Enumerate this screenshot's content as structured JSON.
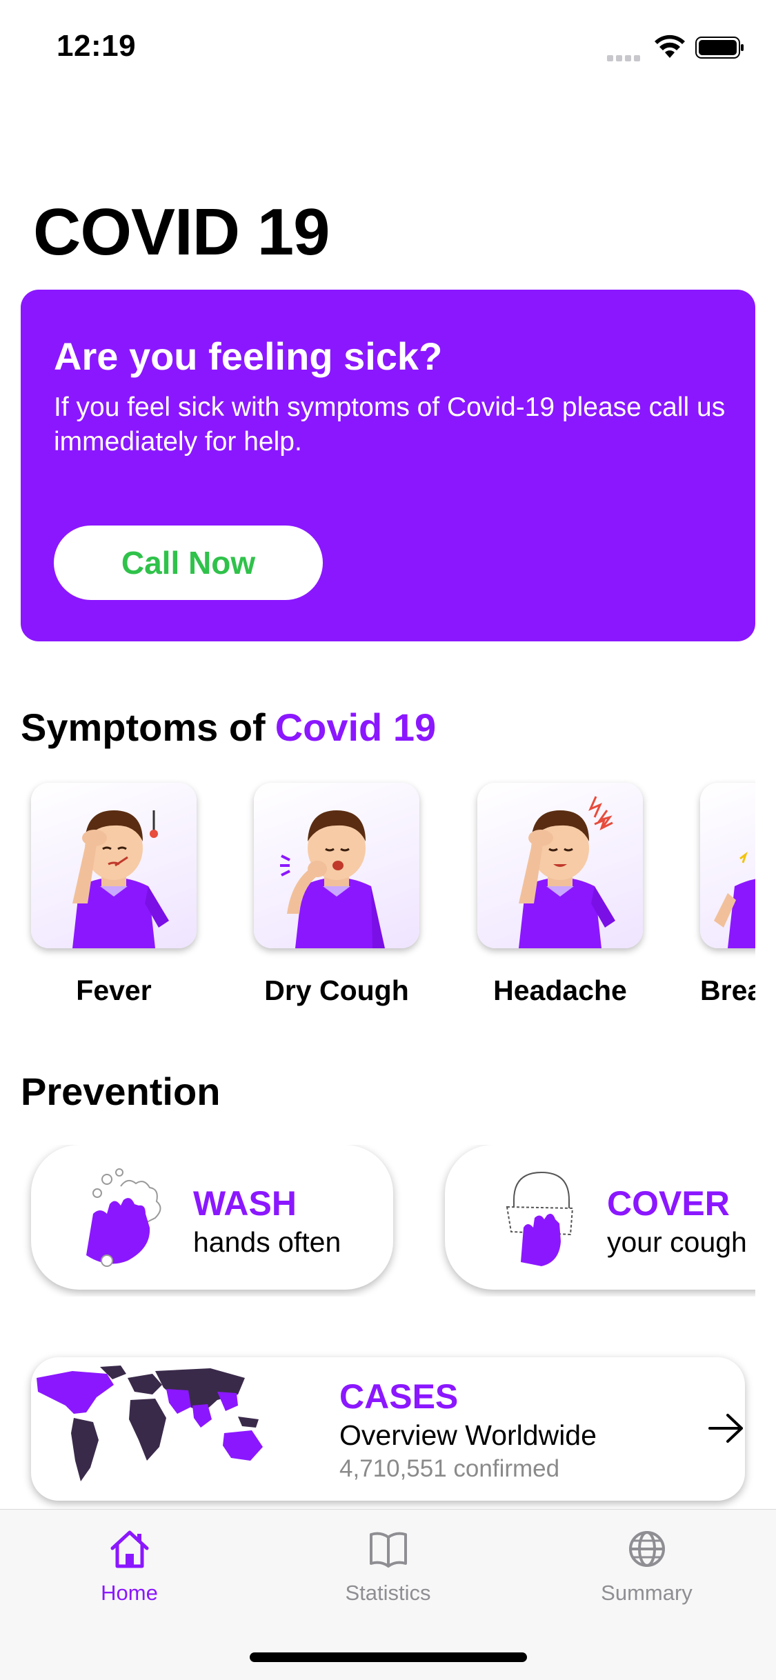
{
  "status_bar": {
    "time": "12:19"
  },
  "page_title": "COVID 19",
  "sick_card": {
    "title": "Are you feeling sick?",
    "text": "If you feel sick with symptoms of Covid-19 please call us immediately for help.",
    "button_label": "Call Now"
  },
  "symptoms_section": {
    "title": "Symptoms of",
    "title_accent": "Covid 19",
    "items": [
      {
        "label": "Fever",
        "icon": "fever-icon"
      },
      {
        "label": "Dry Cough",
        "icon": "dry-cough-icon"
      },
      {
        "label": "Headache",
        "icon": "headache-icon"
      },
      {
        "label": "Breathlessness",
        "icon": "breathing-icon"
      }
    ]
  },
  "prevention_section": {
    "title": "Prevention",
    "items": [
      {
        "heading": "WASH",
        "sub": "hands often",
        "icon": "hand-wash-icon"
      },
      {
        "heading": "COVER",
        "sub": "your cough",
        "icon": "cover-cough-icon"
      }
    ]
  },
  "cases": {
    "heading": "CASES",
    "sub": "Overview Worldwide",
    "count": "4,710,551 confirmed"
  },
  "tab_bar": {
    "tabs": [
      {
        "label": "Home",
        "icon": "home-icon",
        "active": true
      },
      {
        "label": "Statistics",
        "icon": "book-icon",
        "active": false
      },
      {
        "label": "Summary",
        "icon": "globe-icon",
        "active": false
      }
    ]
  },
  "colors": {
    "accent": "#8b17ff",
    "call_green": "#2fc24a",
    "muted": "#8e8e93"
  }
}
